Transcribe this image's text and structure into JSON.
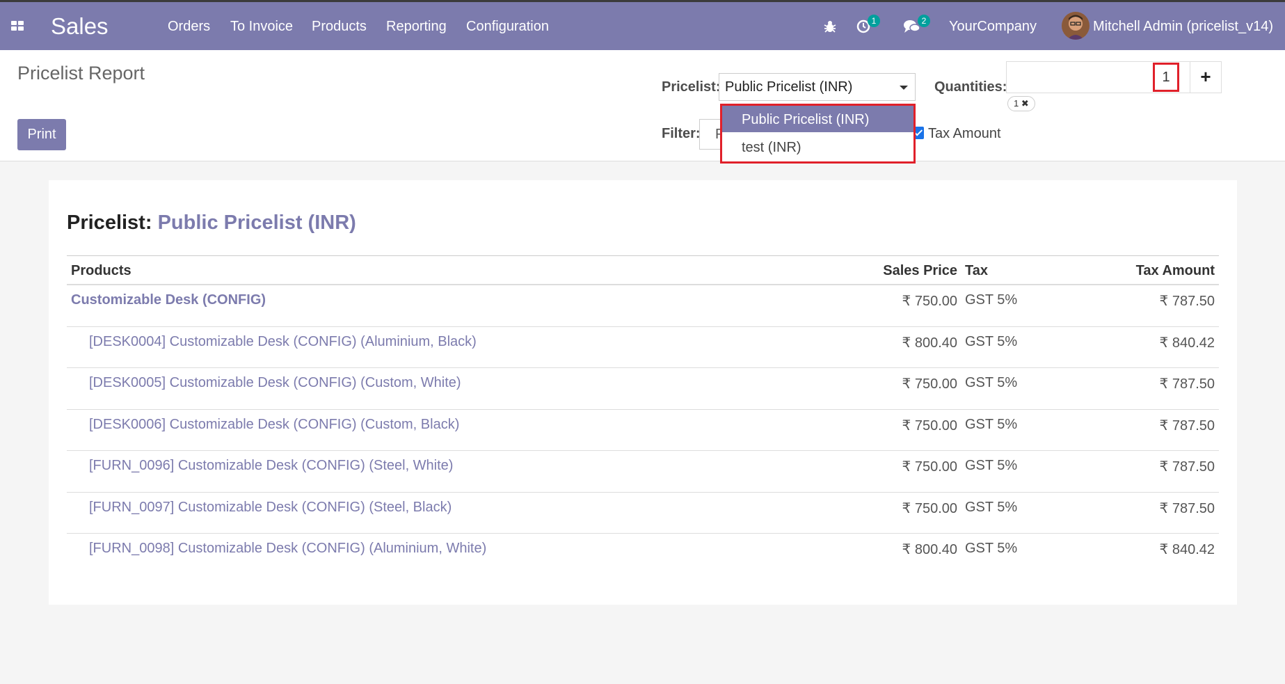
{
  "navbar": {
    "app_name": "Sales",
    "menus": [
      "Orders",
      "To Invoice",
      "Products",
      "Reporting",
      "Configuration"
    ],
    "activity_count": "1",
    "messages_count": "2",
    "company": "YourCompany",
    "user": "Mitchell Admin (pricelist_v14)"
  },
  "control": {
    "title": "Pricelist Report",
    "print_label": "Print",
    "pricelist_label": "Pricelist:",
    "pricelist_value": "Public Pricelist (INR)",
    "filter_label": "Filter:",
    "filter_value": "P",
    "quantities_label": "Quantities:",
    "quantity_value": "1",
    "quantity_add": "+",
    "quantity_chip": "1 ✖",
    "tax_amount_label": "Tax Amount",
    "tax_amount_checked": true,
    "dropdown_options": [
      "Public Pricelist (INR)",
      "test (INR)"
    ],
    "dropdown_selected": "Public Pricelist (INR)"
  },
  "report": {
    "title_prefix": "Pricelist:",
    "title_pricelist": "Public Pricelist (INR)",
    "columns": [
      "Products",
      "Sales Price",
      "Tax",
      "Tax Amount"
    ],
    "rows": [
      {
        "product": "Customizable Desk (CONFIG)",
        "price": "₹ 750.00",
        "tax": "GST 5%",
        "amount": "₹ 787.50"
      },
      {
        "product": "[DESK0004] Customizable Desk (CONFIG) (Aluminium, Black)",
        "price": "₹ 800.40",
        "tax": "GST 5%",
        "amount": "₹ 840.42"
      },
      {
        "product": "[DESK0005] Customizable Desk (CONFIG) (Custom, White)",
        "price": "₹ 750.00",
        "tax": "GST 5%",
        "amount": "₹ 787.50"
      },
      {
        "product": "[DESK0006] Customizable Desk (CONFIG) (Custom, Black)",
        "price": "₹ 750.00",
        "tax": "GST 5%",
        "amount": "₹ 787.50"
      },
      {
        "product": "[FURN_0096] Customizable Desk (CONFIG) (Steel, White)",
        "price": "₹ 750.00",
        "tax": "GST 5%",
        "amount": "₹ 787.50"
      },
      {
        "product": "[FURN_0097] Customizable Desk (CONFIG) (Steel, Black)",
        "price": "₹ 750.00",
        "tax": "GST 5%",
        "amount": "₹ 787.50"
      },
      {
        "product": "[FURN_0098] Customizable Desk (CONFIG) (Aluminium, White)",
        "price": "₹ 800.40",
        "tax": "GST 5%",
        "amount": "₹ 840.42"
      }
    ]
  },
  "colors": {
    "brand": "#7c7bad",
    "highlight": "#e0202a",
    "badge": "#00a09d"
  }
}
